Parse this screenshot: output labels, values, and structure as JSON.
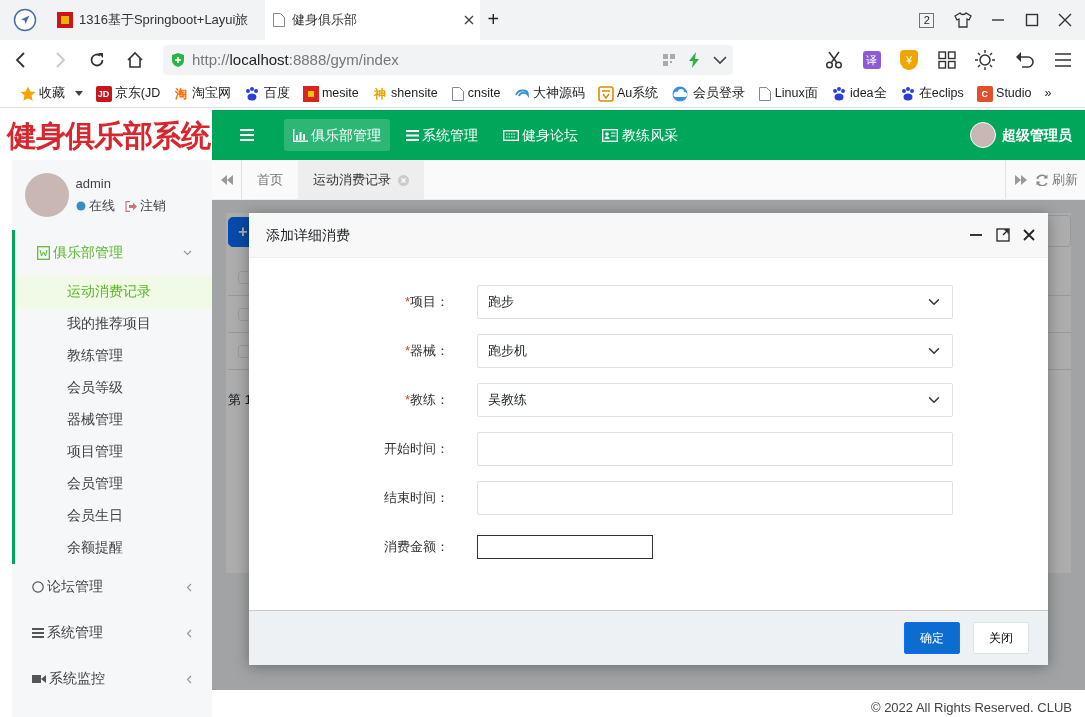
{
  "browser": {
    "tabs": [
      {
        "title": "1316基于Springboot+Layui旅",
        "selected": false
      },
      {
        "title": "健身俱乐部",
        "selected": true
      }
    ],
    "new_tab": "+",
    "window_badge": "2",
    "nav_buttons": [
      {
        "kind": "back",
        "disabled": false
      },
      {
        "kind": "forward",
        "disabled": true
      },
      {
        "kind": "reload",
        "disabled": false
      },
      {
        "kind": "home",
        "disabled": false
      }
    ],
    "address": {
      "scheme": "http://",
      "host": "localhost",
      "path": ":8888/gym/index"
    },
    "toolbar_badges": [
      "译",
      "¥"
    ],
    "bookmarks": [
      {
        "label": "收藏",
        "kind": "star"
      },
      {
        "label": "京东(JD",
        "kind": "text",
        "icon_text": "JD",
        "color": "#c8161d"
      },
      {
        "label": "淘宝网",
        "kind": "char",
        "icon_text": "淘",
        "color": "#ff6a00"
      },
      {
        "label": "百度",
        "kind": "paw"
      },
      {
        "label": "mesite",
        "kind": "square",
        "color": "#d9251d"
      },
      {
        "label": "shensite",
        "kind": "char",
        "icon_text": "神",
        "color": "#e8a400"
      },
      {
        "label": "cnsite",
        "kind": "page"
      },
      {
        "label": "大神源码",
        "kind": "swirl"
      },
      {
        "label": "Au系统",
        "kind": "box"
      },
      {
        "label": "会员登录",
        "kind": "cloud"
      },
      {
        "label": "Linux面",
        "kind": "page"
      },
      {
        "label": "idea全",
        "kind": "paw"
      },
      {
        "label": "在eclips",
        "kind": "paw"
      },
      {
        "label": "Studio",
        "kind": "text",
        "icon_text": "C",
        "color": "#e0502c"
      }
    ],
    "more": "»"
  },
  "app": {
    "logo": "健身俱乐部系统",
    "top_nav": [
      {
        "label": "俱乐部管理",
        "kind": "chart",
        "selected": true
      },
      {
        "label": "系统管理",
        "kind": "list",
        "selected": false
      },
      {
        "label": "健身论坛",
        "kind": "keyboard",
        "selected": false
      },
      {
        "label": "教练风采",
        "kind": "card",
        "selected": false
      }
    ],
    "user_name": "超级管理员",
    "profile": {
      "name": "admin",
      "status": "在线",
      "logout": "注销"
    },
    "menu": [
      {
        "label": "俱乐部管理",
        "kind": "doc",
        "expanded": true,
        "children": [
          {
            "label": "运动消费记录",
            "selected": true
          },
          {
            "label": "我的推荐项目",
            "selected": false
          },
          {
            "label": "教练管理",
            "selected": false
          },
          {
            "label": "会员等级",
            "selected": false
          },
          {
            "label": "器械管理",
            "selected": false
          },
          {
            "label": "项目管理",
            "selected": false
          },
          {
            "label": "会员管理",
            "selected": false
          },
          {
            "label": "会员生日",
            "selected": false
          },
          {
            "label": "余额提醒",
            "selected": false
          }
        ]
      },
      {
        "label": "论坛管理",
        "kind": "circle",
        "expanded": false
      },
      {
        "label": "系统管理",
        "kind": "list",
        "expanded": false
      },
      {
        "label": "系统监控",
        "kind": "camera",
        "expanded": false
      }
    ],
    "page_tabs": [
      {
        "label": "首页",
        "selected": false,
        "closable": false
      },
      {
        "label": "运动消费记录",
        "selected": true,
        "closable": true
      }
    ],
    "refresh": "刷新",
    "background_page": {
      "add_button": "+",
      "rows": [
        {
          "checked": false
        },
        {
          "checked": false
        },
        {
          "checked": false
        }
      ],
      "pager_text": "第 1"
    },
    "footer": "© 2022 All Rights Reserved. CLUB"
  },
  "dialog": {
    "title": "添加详细消费",
    "fields": [
      {
        "label": "项目：",
        "required": true,
        "kind": "select",
        "value": "跑步"
      },
      {
        "label": "器械：",
        "required": true,
        "kind": "select",
        "value": "跑步机"
      },
      {
        "label": "教练：",
        "required": true,
        "kind": "select",
        "value": "吴教练"
      },
      {
        "label": "开始时间：",
        "required": false,
        "kind": "input"
      },
      {
        "label": "结束时间：",
        "required": false,
        "kind": "input"
      },
      {
        "label": "消费金额：",
        "required": false,
        "kind": "small-input"
      }
    ],
    "required_mark": "*",
    "buttons": [
      {
        "label": "确定",
        "kind": "primary"
      },
      {
        "label": "关闭",
        "kind": "secondary"
      }
    ]
  }
}
